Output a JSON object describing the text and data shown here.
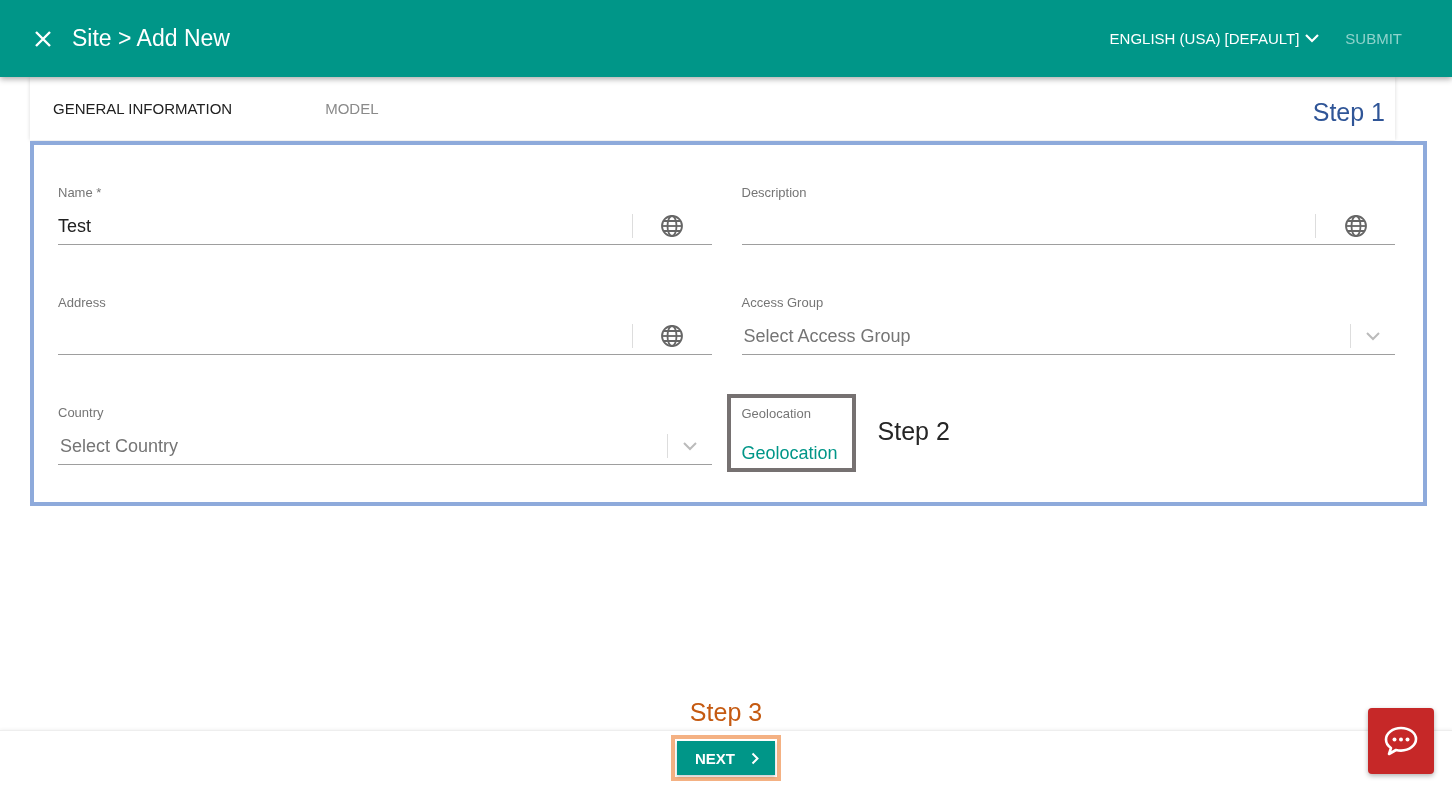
{
  "header": {
    "title": "Site > Add New",
    "language": "ENGLISH (USA) [DEFAULT]",
    "submit": {
      "label": "SUBMIT",
      "disabled": true
    }
  },
  "tabs": [
    {
      "label": "GENERAL INFORMATION",
      "selected": true
    },
    {
      "label": "MODEL",
      "selected": false
    }
  ],
  "form": {
    "annotation": {
      "label": "Step 1",
      "color": "#2f5597",
      "frame": {
        "color": "#8eaadb"
      }
    },
    "fields": [
      {
        "kind": "text",
        "label": "Name *",
        "value": "Test"
      },
      {
        "kind": "text",
        "label": "Description"
      },
      {
        "kind": "text",
        "label": "Address"
      },
      {
        "kind": "select",
        "label": "Access Group",
        "placeholder": "Select Access Group"
      },
      {
        "kind": "select",
        "label": "Country",
        "placeholder": "Select Country"
      },
      {
        "kind": "link",
        "label": "Geolocation",
        "link": "Geolocation",
        "annotation": {
          "label": "Step 2",
          "color": "#262626",
          "frame": {
            "color": "#767171"
          }
        }
      }
    ]
  },
  "footer": {
    "annotation": {
      "label": "Step 3",
      "color": "#c55a11",
      "frame": {
        "color": "#f4b183"
      }
    },
    "next": {
      "label": "NEXT"
    }
  }
}
